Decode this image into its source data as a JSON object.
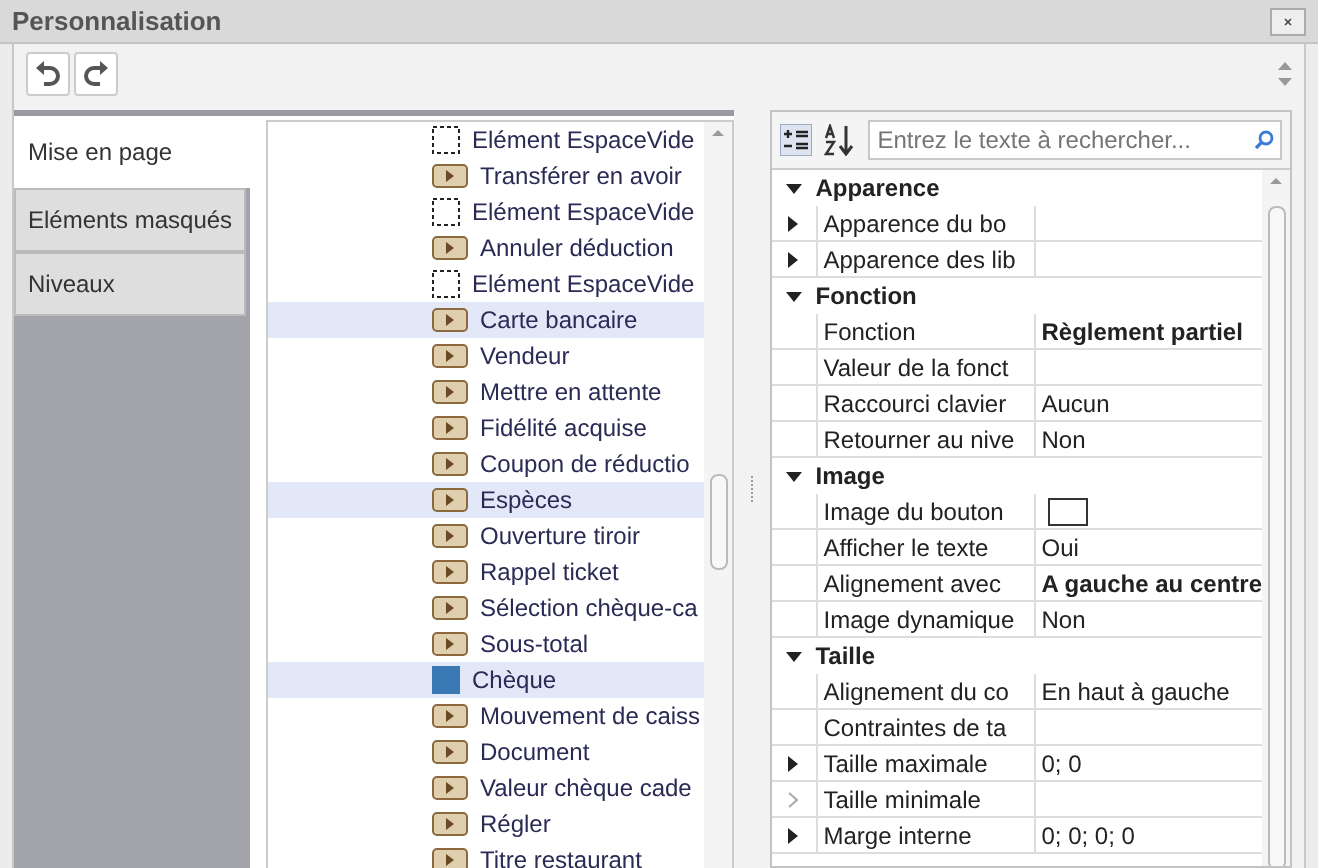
{
  "window": {
    "title": "Personnalisation"
  },
  "toolbar": {
    "buttons": [
      {
        "kind": "undo",
        "disabled": false
      },
      {
        "kind": "redo",
        "disabled": false
      }
    ]
  },
  "tabs": [
    {
      "label": "Mise en page",
      "selected": true
    },
    {
      "label": "Eléments masqués",
      "selected": false
    },
    {
      "label": "Niveaux",
      "selected": false
    }
  ],
  "items": [
    {
      "label": "Elément EspaceVide",
      "kind": "empty",
      "selected": false
    },
    {
      "label": "Transférer en avoir",
      "kind": "action",
      "selected": false
    },
    {
      "label": "Elément EspaceVide",
      "kind": "empty",
      "selected": false
    },
    {
      "label": "Annuler déduction",
      "kind": "action",
      "selected": false
    },
    {
      "label": "Elément EspaceVide",
      "kind": "empty",
      "selected": false
    },
    {
      "label": "Carte bancaire",
      "kind": "action",
      "selected": true
    },
    {
      "label": "Vendeur",
      "kind": "action",
      "selected": false
    },
    {
      "label": "Mettre en attente",
      "kind": "action",
      "selected": false
    },
    {
      "label": "Fidélité acquise",
      "kind": "action",
      "selected": false
    },
    {
      "label": "Coupon de réductio",
      "kind": "action",
      "selected": false
    },
    {
      "label": "Espèces",
      "kind": "action",
      "selected": true
    },
    {
      "label": "Ouverture tiroir",
      "kind": "action",
      "selected": false
    },
    {
      "label": "Rappel ticket",
      "kind": "action",
      "selected": false
    },
    {
      "label": "Sélection chèque-ca",
      "kind": "action",
      "selected": false
    },
    {
      "label": "Sous-total",
      "kind": "action",
      "selected": false
    },
    {
      "label": "Chèque",
      "kind": "color",
      "color": "#3a78b5",
      "selected": true
    },
    {
      "label": "Mouvement de caiss",
      "kind": "action",
      "selected": false
    },
    {
      "label": "Document",
      "kind": "action",
      "selected": false
    },
    {
      "label": "Valeur chèque cade",
      "kind": "action",
      "selected": false
    },
    {
      "label": "Régler",
      "kind": "action",
      "selected": false
    },
    {
      "label": "Titre restaurant",
      "kind": "action",
      "selected": false
    }
  ],
  "properties": {
    "search": {
      "placeholder": "Entrez le texte à rechercher..."
    },
    "categories": [
      {
        "name": "Apparence",
        "expanded": true,
        "rows": [
          {
            "name": "Apparence du bo",
            "value": "",
            "expandable": true,
            "expander_disabled": false
          },
          {
            "name": "Apparence des lib",
            "value": "",
            "expandable": true,
            "expander_disabled": false
          }
        ]
      },
      {
        "name": "Fonction",
        "expanded": true,
        "rows": [
          {
            "name": "Fonction",
            "value": "Règlement partiel",
            "bold": true
          },
          {
            "name": "Valeur de la fonct",
            "value": ""
          },
          {
            "name": "Raccourci clavier",
            "value": "Aucun"
          },
          {
            "name": "Retourner au nive",
            "value": "Non"
          }
        ]
      },
      {
        "name": "Image",
        "expanded": true,
        "rows": [
          {
            "name": "Image du bouton",
            "kind": "image"
          },
          {
            "name": "Afficher le texte",
            "value": "Oui"
          },
          {
            "name": "Alignement avec",
            "value": "A gauche au centre",
            "bold": true
          },
          {
            "name": "Image dynamique",
            "value": "Non"
          }
        ]
      },
      {
        "name": "Taille",
        "expanded": true,
        "rows": [
          {
            "name": "Alignement du co",
            "value": "En haut à gauche"
          },
          {
            "name": "Contraintes de ta",
            "value": ""
          },
          {
            "name": "Taille maximale",
            "value": "0; 0",
            "expandable": true,
            "expander_disabled": false
          },
          {
            "name": "Taille minimale",
            "value": "",
            "expandable": true,
            "expander_disabled": true
          },
          {
            "name": "Marge interne",
            "value": "0; 0; 0; 0",
            "expandable": true,
            "expander_disabled": false
          }
        ]
      }
    ]
  }
}
